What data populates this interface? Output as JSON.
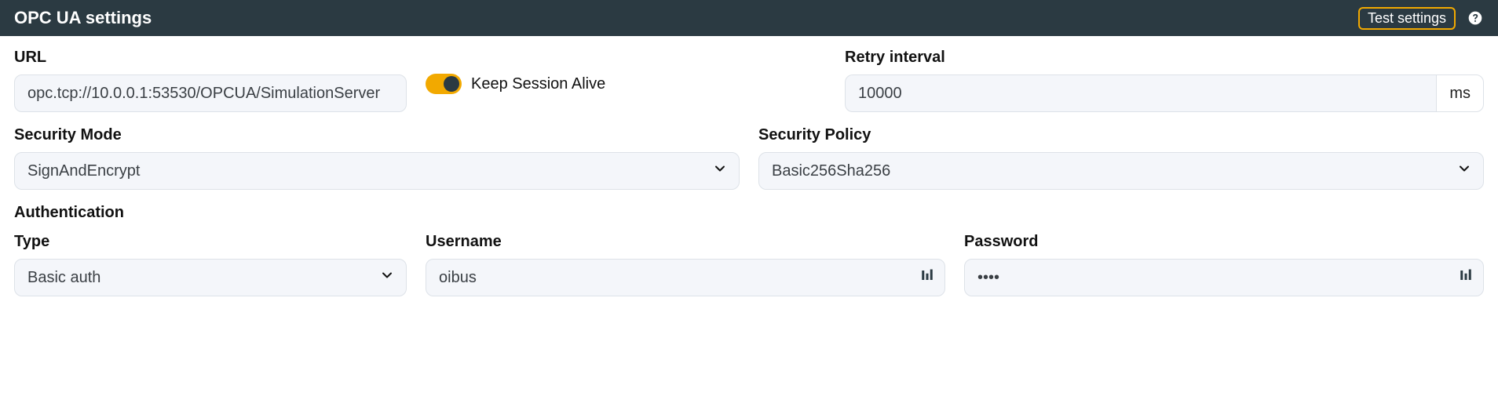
{
  "header": {
    "title": "OPC UA settings",
    "test_button": "Test settings"
  },
  "fields": {
    "url_label": "URL",
    "url_value": "opc.tcp://10.0.0.1:53530/OPCUA/SimulationServer",
    "keep_session_label": "Keep Session Alive",
    "keep_session_on": true,
    "retry_label": "Retry interval",
    "retry_value": "10000",
    "retry_unit": "ms",
    "security_mode_label": "Security Mode",
    "security_mode_value": "SignAndEncrypt",
    "security_policy_label": "Security Policy",
    "security_policy_value": "Basic256Sha256",
    "auth_section": "Authentication",
    "type_label": "Type",
    "type_value": "Basic auth",
    "username_label": "Username",
    "username_value": "oibus",
    "password_label": "Password",
    "password_value": "••••"
  }
}
